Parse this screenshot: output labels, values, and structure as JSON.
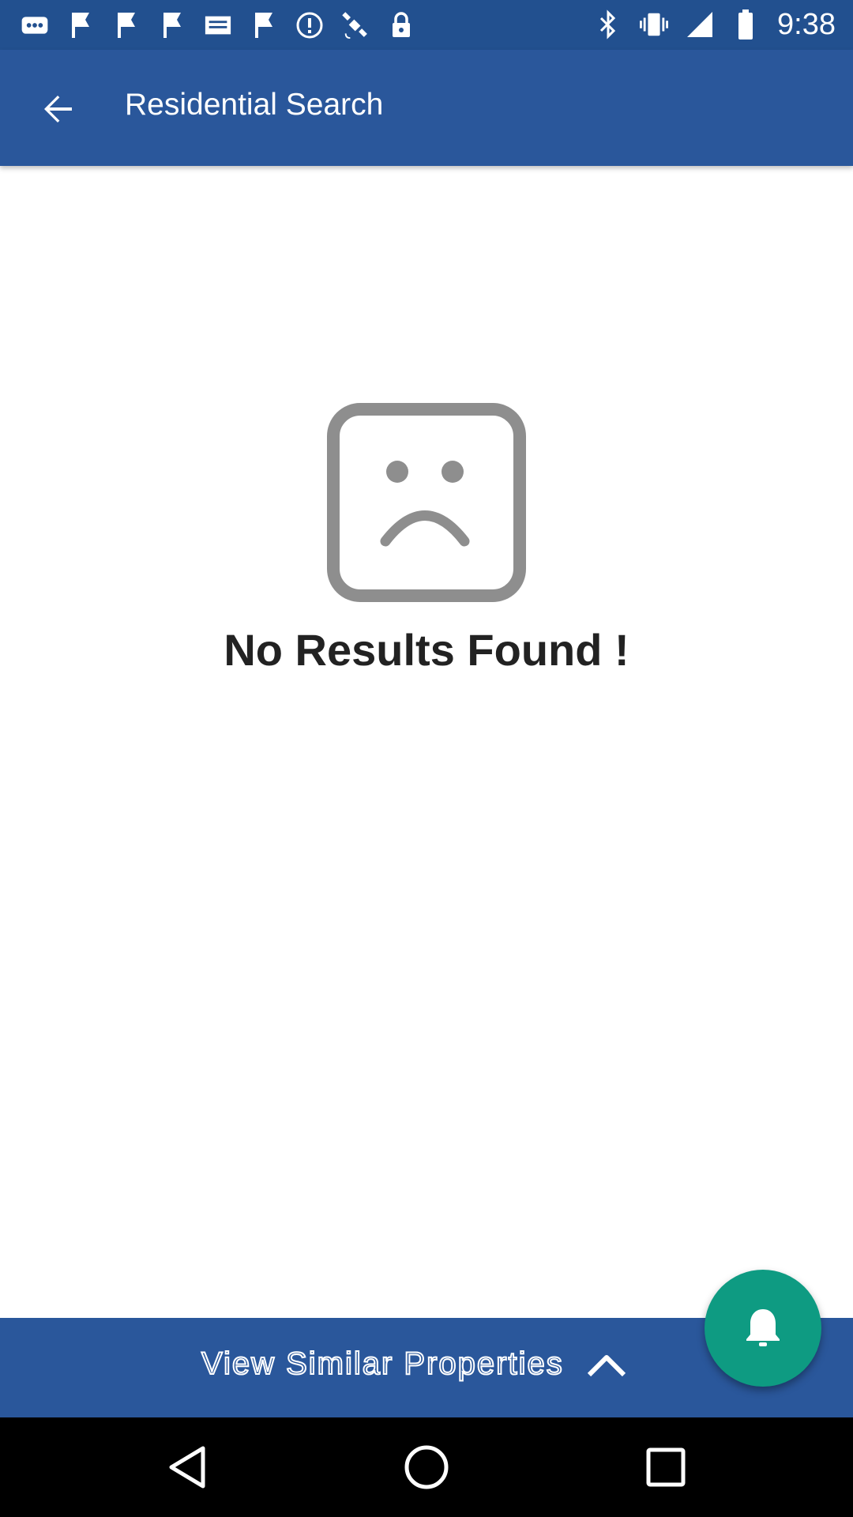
{
  "status_bar": {
    "time": "9:38",
    "left_icons": [
      "more-icon",
      "flag-icon",
      "flag-icon",
      "flag-icon",
      "mail-icon",
      "flag-icon",
      "alert-icon",
      "satellite-icon",
      "lock-icon"
    ],
    "right_icons": [
      "bluetooth-icon",
      "vibrate-icon",
      "signal-icon",
      "battery-icon"
    ]
  },
  "app_bar": {
    "title": "Residential Search",
    "back_icon": "arrow-back-icon",
    "background": "#2a579b"
  },
  "empty_state": {
    "icon": "sad-face-icon",
    "message": "No Results Found !"
  },
  "similar_bar": {
    "label": "View Similar Properties",
    "icon": "chevron-up-icon"
  },
  "fab": {
    "icon": "bell-icon",
    "color": "#0e9b82"
  },
  "nav_bar": {
    "buttons": [
      "back-triangle-icon",
      "home-circle-icon",
      "recents-square-icon"
    ]
  }
}
